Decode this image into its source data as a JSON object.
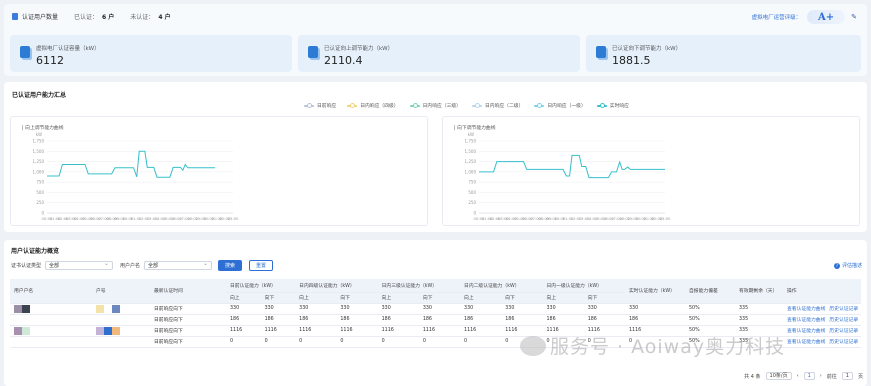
{
  "header": {
    "title": "认证用户数量",
    "certified_label": "已认证：",
    "certified_value": "6 户",
    "uncertified_label": "未认证：",
    "uncertified_value": "4 户",
    "rating_label": "虚拟电厂运营评级：",
    "rating_value": "A+"
  },
  "cards": [
    {
      "label": "虚拟电厂认证容量（kW）",
      "value": "6112"
    },
    {
      "label": "已认证向上调节能力（kW）",
      "value": "2110.4"
    },
    {
      "label": "已认证向下调节能力（kW）",
      "value": "1881.5"
    }
  ],
  "summary": {
    "title": "已认证用户能力汇总",
    "legend": [
      {
        "name": "日前响应",
        "color": "#b9c3d6"
      },
      {
        "name": "日内响应（四级）",
        "color": "#f2d27a"
      },
      {
        "name": "日内响应（三级）",
        "color": "#7fd3b8"
      },
      {
        "name": "日内响应（二级）",
        "color": "#b8d7ee"
      },
      {
        "name": "日内响应（一级）",
        "color": "#7fcfe6"
      },
      {
        "name": "实时响应",
        "color": "#36c0c9"
      }
    ]
  },
  "chart_data": [
    {
      "type": "line",
      "title": "| 向上调节能力曲线",
      "ylabel": "kW",
      "y_ticks": [
        "1,750",
        "1,500",
        "1,250",
        "1,000",
        "750",
        "500",
        "250",
        "0"
      ],
      "ylim": [
        0,
        1750
      ],
      "x": [
        "00:00",
        "01:00",
        "02:00",
        "03:00",
        "04:00",
        "05:00",
        "06:00",
        "07:00",
        "08:00",
        "09:00",
        "10:00",
        "11:00",
        "12:00",
        "13:00",
        "14:00",
        "15:00",
        "16:00",
        "17:00",
        "18:00",
        "19:00",
        "20:00",
        "21:00",
        "22:00",
        "23:00"
      ],
      "series": [
        {
          "color": "#36c0c9",
          "points": [
            [
              0,
              900
            ],
            [
              1.5,
              900
            ],
            [
              1.9,
              1180
            ],
            [
              4.7,
              1180
            ],
            [
              5.1,
              950
            ],
            [
              8,
              950
            ],
            [
              8.4,
              1100
            ],
            [
              10.7,
              1100
            ],
            [
              11.1,
              880
            ],
            [
              11.4,
              1500
            ],
            [
              12.1,
              1500
            ],
            [
              12.4,
              1110
            ],
            [
              13.2,
              1110
            ],
            [
              13.6,
              870
            ],
            [
              15.2,
              870
            ],
            [
              15.6,
              1110
            ],
            [
              16.5,
              1110
            ],
            [
              16.8,
              1040
            ],
            [
              17.1,
              1180
            ],
            [
              17.4,
              1100
            ],
            [
              20.8,
              1100
            ]
          ]
        }
      ]
    },
    {
      "type": "line",
      "title": "| 向下调节能力曲线",
      "ylabel": "kW",
      "y_ticks": [
        "1,750",
        "1,500",
        "1,250",
        "1,000",
        "750",
        "500",
        "250",
        "0"
      ],
      "ylim": [
        0,
        1750
      ],
      "x": [
        "00:00",
        "01:00",
        "02:00",
        "03:00",
        "04:00",
        "05:00",
        "06:00",
        "07:00",
        "08:00",
        "09:00",
        "10:00",
        "11:00",
        "12:00",
        "13:00",
        "14:00",
        "15:00",
        "16:00",
        "17:00",
        "18:00",
        "19:00",
        "20:00",
        "21:00",
        "22:00",
        "23:00"
      ],
      "series": [
        {
          "color": "#36c0c9",
          "points": [
            [
              0,
              1000
            ],
            [
              1.8,
              1000
            ],
            [
              2.2,
              1250
            ],
            [
              5.5,
              1250
            ],
            [
              5.9,
              1060
            ],
            [
              10.4,
              1060
            ],
            [
              10.8,
              900
            ],
            [
              11.2,
              900
            ],
            [
              11.5,
              1400
            ],
            [
              12.4,
              1400
            ],
            [
              12.7,
              1130
            ],
            [
              13.2,
              1130
            ],
            [
              13.6,
              860
            ],
            [
              16,
              860
            ],
            [
              16.4,
              1000
            ],
            [
              17,
              1000
            ],
            [
              17.4,
              1240
            ],
            [
              17.7,
              1060
            ],
            [
              18,
              1060
            ],
            [
              18.4,
              1120
            ],
            [
              18.7,
              1060
            ],
            [
              20,
              1060
            ],
            [
              24,
              1060
            ]
          ]
        }
      ]
    }
  ],
  "table": {
    "title": "用户认证能力概览",
    "filters": [
      {
        "label": "证书认证类型",
        "value": "全部"
      },
      {
        "label": "用户户名",
        "value": "全部"
      }
    ],
    "search_label": "搜索",
    "reset_label": "重置",
    "help_label": "评估描述",
    "columns": [
      "用户户名",
      "户号",
      "最新认证时间",
      "日前认证能力（kW）",
      "日内四级认证能力（kW）",
      "日内三级认证能力（kW）",
      "日内二级认证能力（kW）",
      "日内一级认证能力（kW）",
      "实时认证能力（kW）",
      "自报能力偏差",
      "有效期剩余（天）",
      "操作"
    ],
    "sub_columns": [
      "向上",
      "向下",
      "向上",
      "向下",
      "向上",
      "向下",
      "向上",
      "向下",
      "向上",
      "向下"
    ],
    "rows": [
      {
        "time": "日前响应向下",
        "vals": [
          "330",
          "330",
          "330",
          "330",
          "330",
          "330",
          "330",
          "330",
          "330",
          "330"
        ],
        "rt": "330",
        "dev": "50%",
        "days": "335",
        "op1": "查看认证能力曲线",
        "op2": "历史认证记录",
        "colors": [
          "#9b8fa8",
          "#3c4350"
        ],
        "hcolors": [
          "#f5e2a6",
          "#fff",
          "#6c88c0"
        ]
      },
      {
        "time": "日前响应向下",
        "vals": [
          "186",
          "186",
          "186",
          "186",
          "186",
          "186",
          "186",
          "186",
          "186",
          "186"
        ],
        "rt": "186",
        "dev": "50%",
        "days": "335",
        "op1": "查看认证能力曲线",
        "op2": "历史认证记录",
        "colors": [],
        "hcolors": []
      },
      {
        "time": "日前响应向下",
        "vals": [
          "1116",
          "1116",
          "1116",
          "1116",
          "1116",
          "1116",
          "1116",
          "1116",
          "1116",
          "1116"
        ],
        "rt": "1116",
        "dev": "50%",
        "days": "335",
        "op1": "查看认证能力曲线",
        "op2": "历史认证记录",
        "colors": [
          "#a98fb0",
          "#cfe9d8"
        ],
        "hcolors": [
          "#c3b3d6",
          "#2f6fd0",
          "#f1b77c"
        ]
      },
      {
        "time": "日前响应向下",
        "vals": [
          "0",
          "0",
          "0",
          "0",
          "0",
          "0",
          "0",
          "0",
          "0",
          "0"
        ],
        "rt": "0",
        "dev": "50%",
        "days": "335",
        "op1": "查看认证能力曲线",
        "op2": "历史认证记录",
        "colors": [],
        "hcolors": []
      }
    ],
    "pager": {
      "total": "共 4 条",
      "size": "10条/页",
      "page": "1",
      "goto": "前往",
      "goto_page": "1",
      "suffix": "页"
    }
  },
  "watermark": "服务号 · Aoiway奥力科技"
}
